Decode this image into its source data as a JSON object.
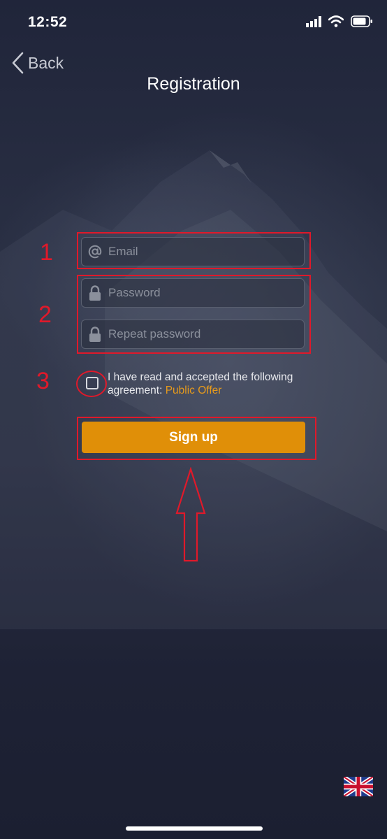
{
  "status_bar": {
    "time": "12:52"
  },
  "nav": {
    "back_label": "Back",
    "title": "Registration"
  },
  "form": {
    "email_placeholder": "Email",
    "password_placeholder": "Password",
    "repeat_password_placeholder": "Repeat password",
    "agreement_text": "I have read and accepted the following agreement: ",
    "agreement_link": "Public Offer",
    "signup_label": "Sign up"
  },
  "annotations": {
    "step1": "1",
    "step2": "2",
    "step3": "3"
  },
  "colors": {
    "accent": "#e08f08",
    "link": "#e69a1c",
    "annotation": "#e0192a",
    "background": "#1c2133"
  },
  "icons": [
    "signal-icon",
    "wifi-icon",
    "battery-icon",
    "chevron-left-icon",
    "at-icon",
    "lock-icon",
    "uk-flag-icon",
    "arrow-up-icon"
  ]
}
